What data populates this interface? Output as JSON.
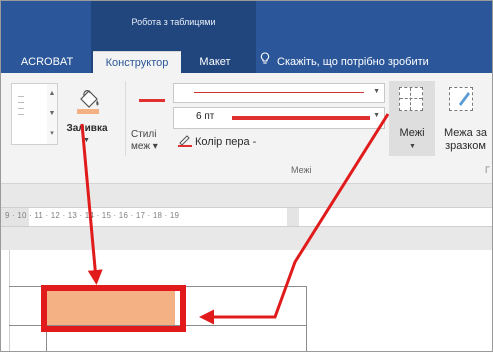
{
  "title_bar": {
    "context_group": "Робота з таблицями"
  },
  "tabs": [
    {
      "label": "ACROBAT"
    },
    {
      "label": "Конструктор"
    },
    {
      "label": "Макет"
    }
  ],
  "tell_me": {
    "text": "Скажіть, що потрібно зробити",
    "icon": "lightbulb-icon"
  },
  "ribbon": {
    "shading": {
      "label": "Заливка",
      "icon": "paint-bucket-icon"
    },
    "border_styles": {
      "label_line1": "Стилі",
      "label_line2": "меж"
    },
    "line_style": {
      "icon": "line-style-combo"
    },
    "line_weight": {
      "value": "6 пт"
    },
    "pen_color": {
      "label": "Колір пера -",
      "icon": "pen-color-icon"
    },
    "borders": {
      "label": "Межі",
      "icon": "borders-icon"
    },
    "border_painter": {
      "label_line1": "Межа за",
      "label_line2": "зразком",
      "icon": "border-painter-icon"
    },
    "group_label": "Межі",
    "group_label_right": "Г"
  },
  "ruler": {
    "text": "9 · 10 · 11 · 12 · 13 · 14 · 15 · 16 · 17 · 18 · 19"
  },
  "colors": {
    "title_bar": "#2b579a",
    "cell_shading": "#f4b183",
    "highlight": "#e11b1b"
  }
}
